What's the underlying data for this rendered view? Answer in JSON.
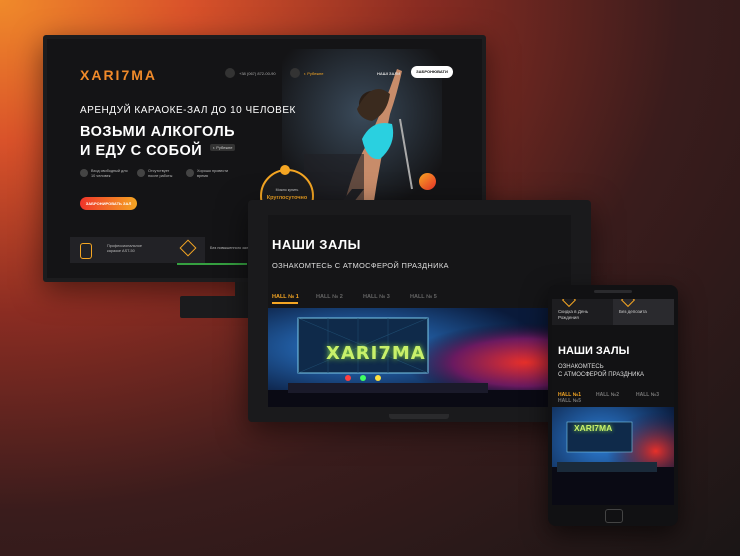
{
  "colors": {
    "accent": "#f5a623",
    "brand": "#f08a2a",
    "bg_dark": "#141416"
  },
  "desktop": {
    "logo": "XARI7MA",
    "phone": "+38 (067) 872-00-90",
    "location": "г. Рубежне",
    "nav_label": "НАШІ ЗАЛИ",
    "cta_top": "ЗАБРОНЮВАТИ",
    "hero_small": "АРЕНДУЙ КАРАОКЕ-ЗАЛ ДО 10 ЧЕЛОВЕК",
    "hero_big_line1": "ВОЗЬМИ АЛКОГОЛЬ",
    "hero_big_line2": "И ЕДУ С СОБОЙ",
    "hero_tag": "г. Рубежне",
    "features": [
      {
        "text": "Вход свободный для 10 человек",
        "icon": "check-icon"
      },
      {
        "text": "Отсутствует после работы",
        "icon": "check-icon"
      },
      {
        "text": "Хорошо провести время",
        "icon": "check-icon"
      }
    ],
    "cta_main": "ЗАБРОНИРОВАТЬ ЗАЛ",
    "badge_small": "Можно купить",
    "badge_big": "Круглосуточно",
    "bottom_items": [
      {
        "text": "Профессиональное караоке AST-50",
        "icon": "microphone-icon"
      },
      {
        "text": "Без повышенного залога",
        "icon": "pencil-icon"
      }
    ]
  },
  "laptop": {
    "title": "НАШИ ЗАЛЫ",
    "subtitle": "ОЗНАКОМТЕСЬ С АТМОСФЕРОЙ ПРАЗДНИКА",
    "tabs": [
      "HALL № 1",
      "HALL № 2",
      "HALL № 3",
      "HALL № 5"
    ],
    "sign": "XARI7MA"
  },
  "phone": {
    "top_items": [
      "Скидка в День Рождения",
      "Без депозита"
    ],
    "title": "НАШИ ЗАЛЫ",
    "subtitle_line1": "ОЗНАКОМТЕСЬ",
    "subtitle_line2": "С АТМОСФЕРОЙ ПРАЗДНИКА",
    "tabs": [
      "HALL №1",
      "HALL №2",
      "HALL №3",
      "HALL №5"
    ],
    "sign": "XARI7MA"
  }
}
